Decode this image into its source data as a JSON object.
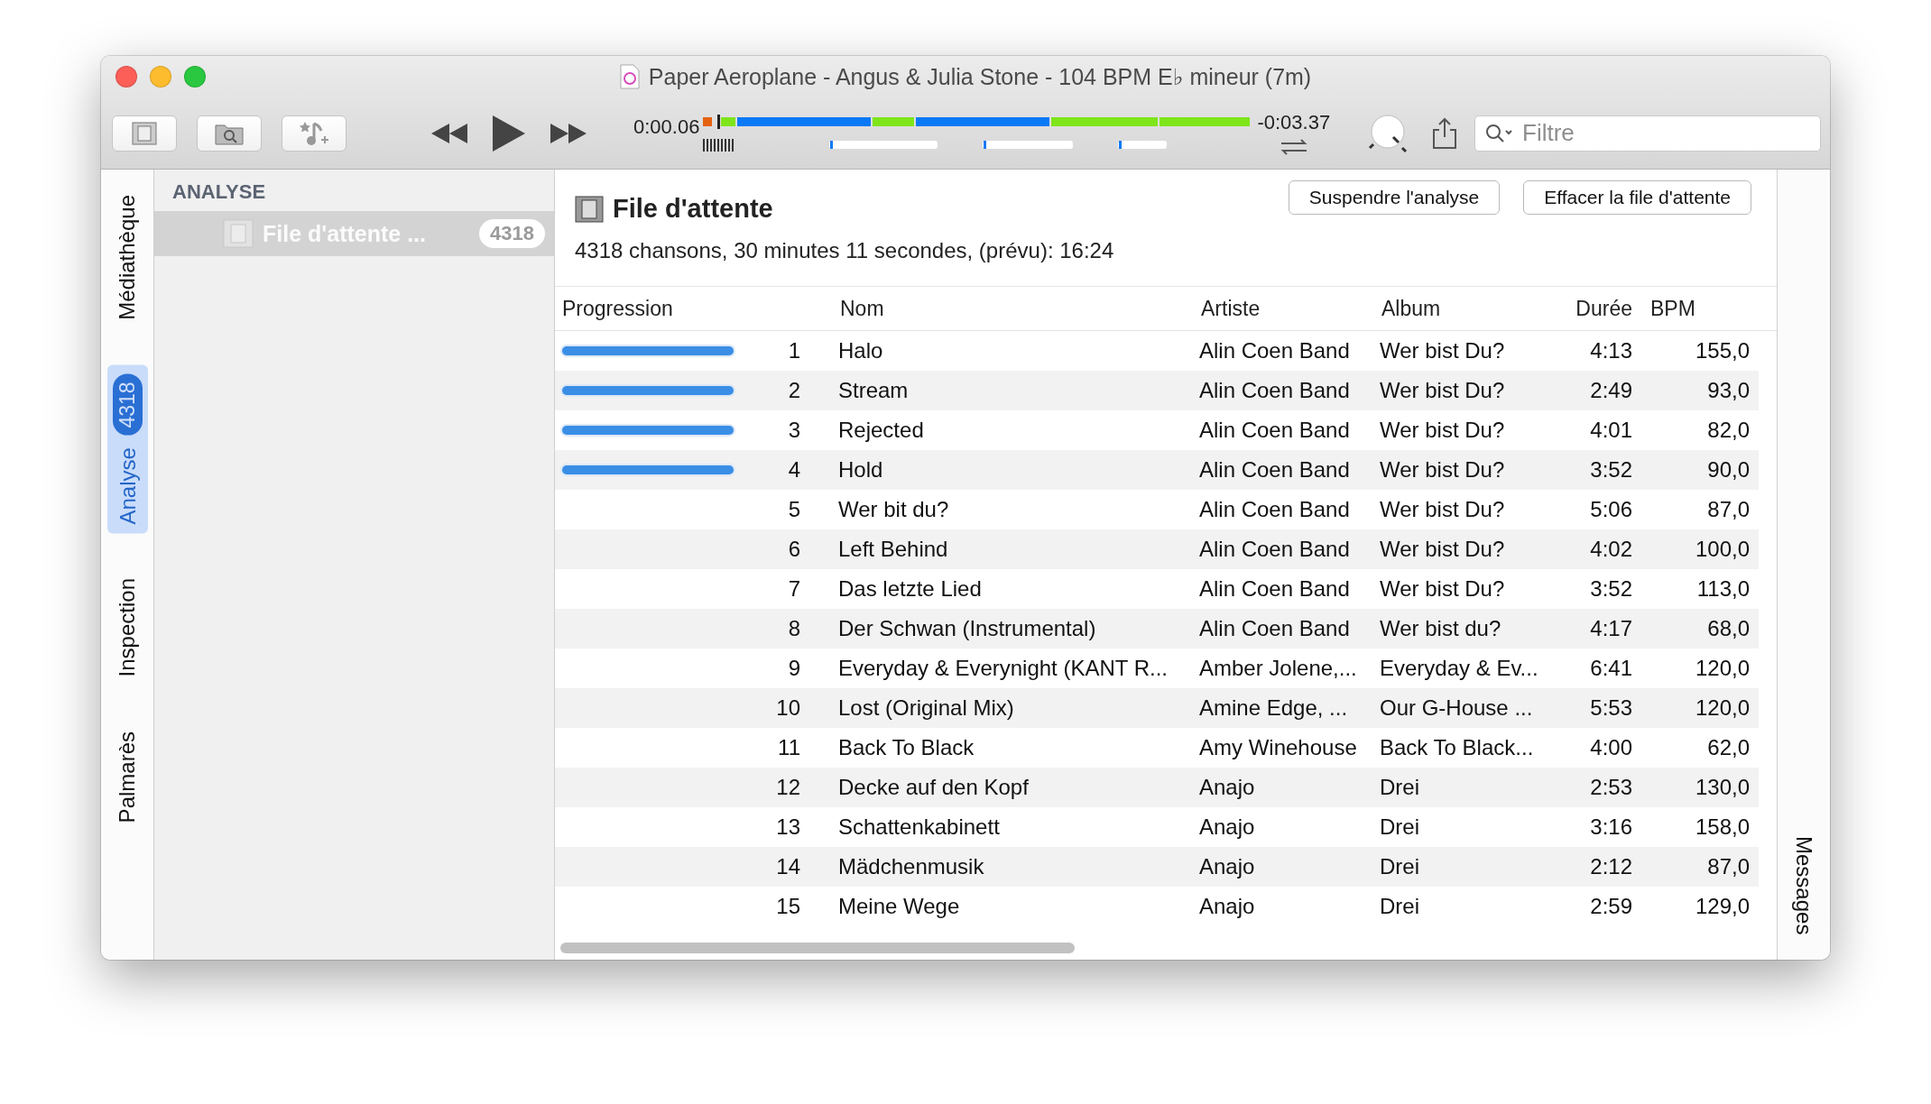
{
  "window": {
    "title": "Paper Aeroplane - Angus & Julia Stone - 104 BPM E♭ mineur (7m)"
  },
  "player": {
    "elapsed": "0:00.06",
    "remaining": "-0:03.37",
    "search": {
      "placeholder": "Filtre"
    }
  },
  "left_tabs": [
    {
      "label": "Médiathèque",
      "selected": false
    },
    {
      "label": "Analyse",
      "selected": true,
      "badge": "4318"
    },
    {
      "label": "Inspection",
      "selected": false
    },
    {
      "label": "Palmarès",
      "selected": false
    }
  ],
  "right_tabs": [
    {
      "label": "Messages",
      "selected": false
    }
  ],
  "sidebar": {
    "header": "ANALYSE",
    "items": [
      {
        "label": "File d'attente ...",
        "count": "4318",
        "selected": true
      }
    ]
  },
  "queue": {
    "title": "File d'attente",
    "summary": "4318 chansons, 30 minutes 11 secondes, (prévu): 16:24",
    "buttons": [
      "Suspendre l'analyse",
      "Effacer la file d'attente"
    ]
  },
  "table": {
    "columns": [
      "Progression",
      "Nom",
      "Artiste",
      "Album",
      "Durée",
      "BPM"
    ],
    "rows": [
      {
        "level": 1,
        "number": "1",
        "name": "Halo",
        "artist": "Alin Coen Band",
        "album": "Wer bist Du?",
        "duration": "4:13",
        "bpm": "155,0"
      },
      {
        "level": 1,
        "number": "2",
        "name": "Stream",
        "artist": "Alin Coen Band",
        "album": "Wer bist Du?",
        "duration": "2:49",
        "bpm": "93,0"
      },
      {
        "level": 1,
        "number": "3",
        "name": "Rejected",
        "artist": "Alin Coen Band",
        "album": "Wer bist Du?",
        "duration": "4:01",
        "bpm": "82,0"
      },
      {
        "level": 1,
        "number": "4",
        "name": "Hold",
        "artist": "Alin Coen Band",
        "album": "Wer bist Du?",
        "duration": "3:52",
        "bpm": "90,0"
      },
      {
        "number": "5",
        "name": "Wer bit du?",
        "artist": "Alin Coen Band",
        "album": "Wer bist Du?",
        "duration": "5:06",
        "bpm": "87,0"
      },
      {
        "number": "6",
        "name": "Left Behind",
        "artist": "Alin Coen Band",
        "album": "Wer bist Du?",
        "duration": "4:02",
        "bpm": "100,0"
      },
      {
        "number": "7",
        "name": "Das letzte Lied",
        "artist": "Alin Coen Band",
        "album": "Wer bist Du?",
        "duration": "3:52",
        "bpm": "113,0"
      },
      {
        "number": "8",
        "name": "Der Schwan (Instrumental)",
        "artist": "Alin Coen Band",
        "album": "Wer bist du?",
        "duration": "4:17",
        "bpm": "68,0"
      },
      {
        "number": "9",
        "name": "Everyday & Everynight (KANT R...",
        "artist": "Amber Jolene,...",
        "album": "Everyday & Ev...",
        "duration": "6:41",
        "bpm": "120,0"
      },
      {
        "number": "10",
        "name": "Lost (Original Mix)",
        "artist": "Amine Edge, ...",
        "album": "Our G-House ...",
        "duration": "5:53",
        "bpm": "120,0"
      },
      {
        "number": "11",
        "name": "Back To Black",
        "artist": "Amy Winehouse",
        "album": "Back To Black...",
        "duration": "4:00",
        "bpm": "62,0"
      },
      {
        "number": "12",
        "name": "Decke auf den Kopf",
        "artist": "Anajo",
        "album": "Drei",
        "duration": "2:53",
        "bpm": "130,0"
      },
      {
        "number": "13",
        "name": "Schattenkabinett",
        "artist": "Anajo",
        "album": "Drei",
        "duration": "3:16",
        "bpm": "158,0"
      },
      {
        "number": "14",
        "name": "Mädchenmusik",
        "artist": "Anajo",
        "album": "Drei",
        "duration": "2:12",
        "bpm": "87,0"
      },
      {
        "number": "15",
        "name": "Meine Wege",
        "artist": "Anajo",
        "album": "Drei",
        "duration": "2:59",
        "bpm": "129,0"
      }
    ]
  }
}
